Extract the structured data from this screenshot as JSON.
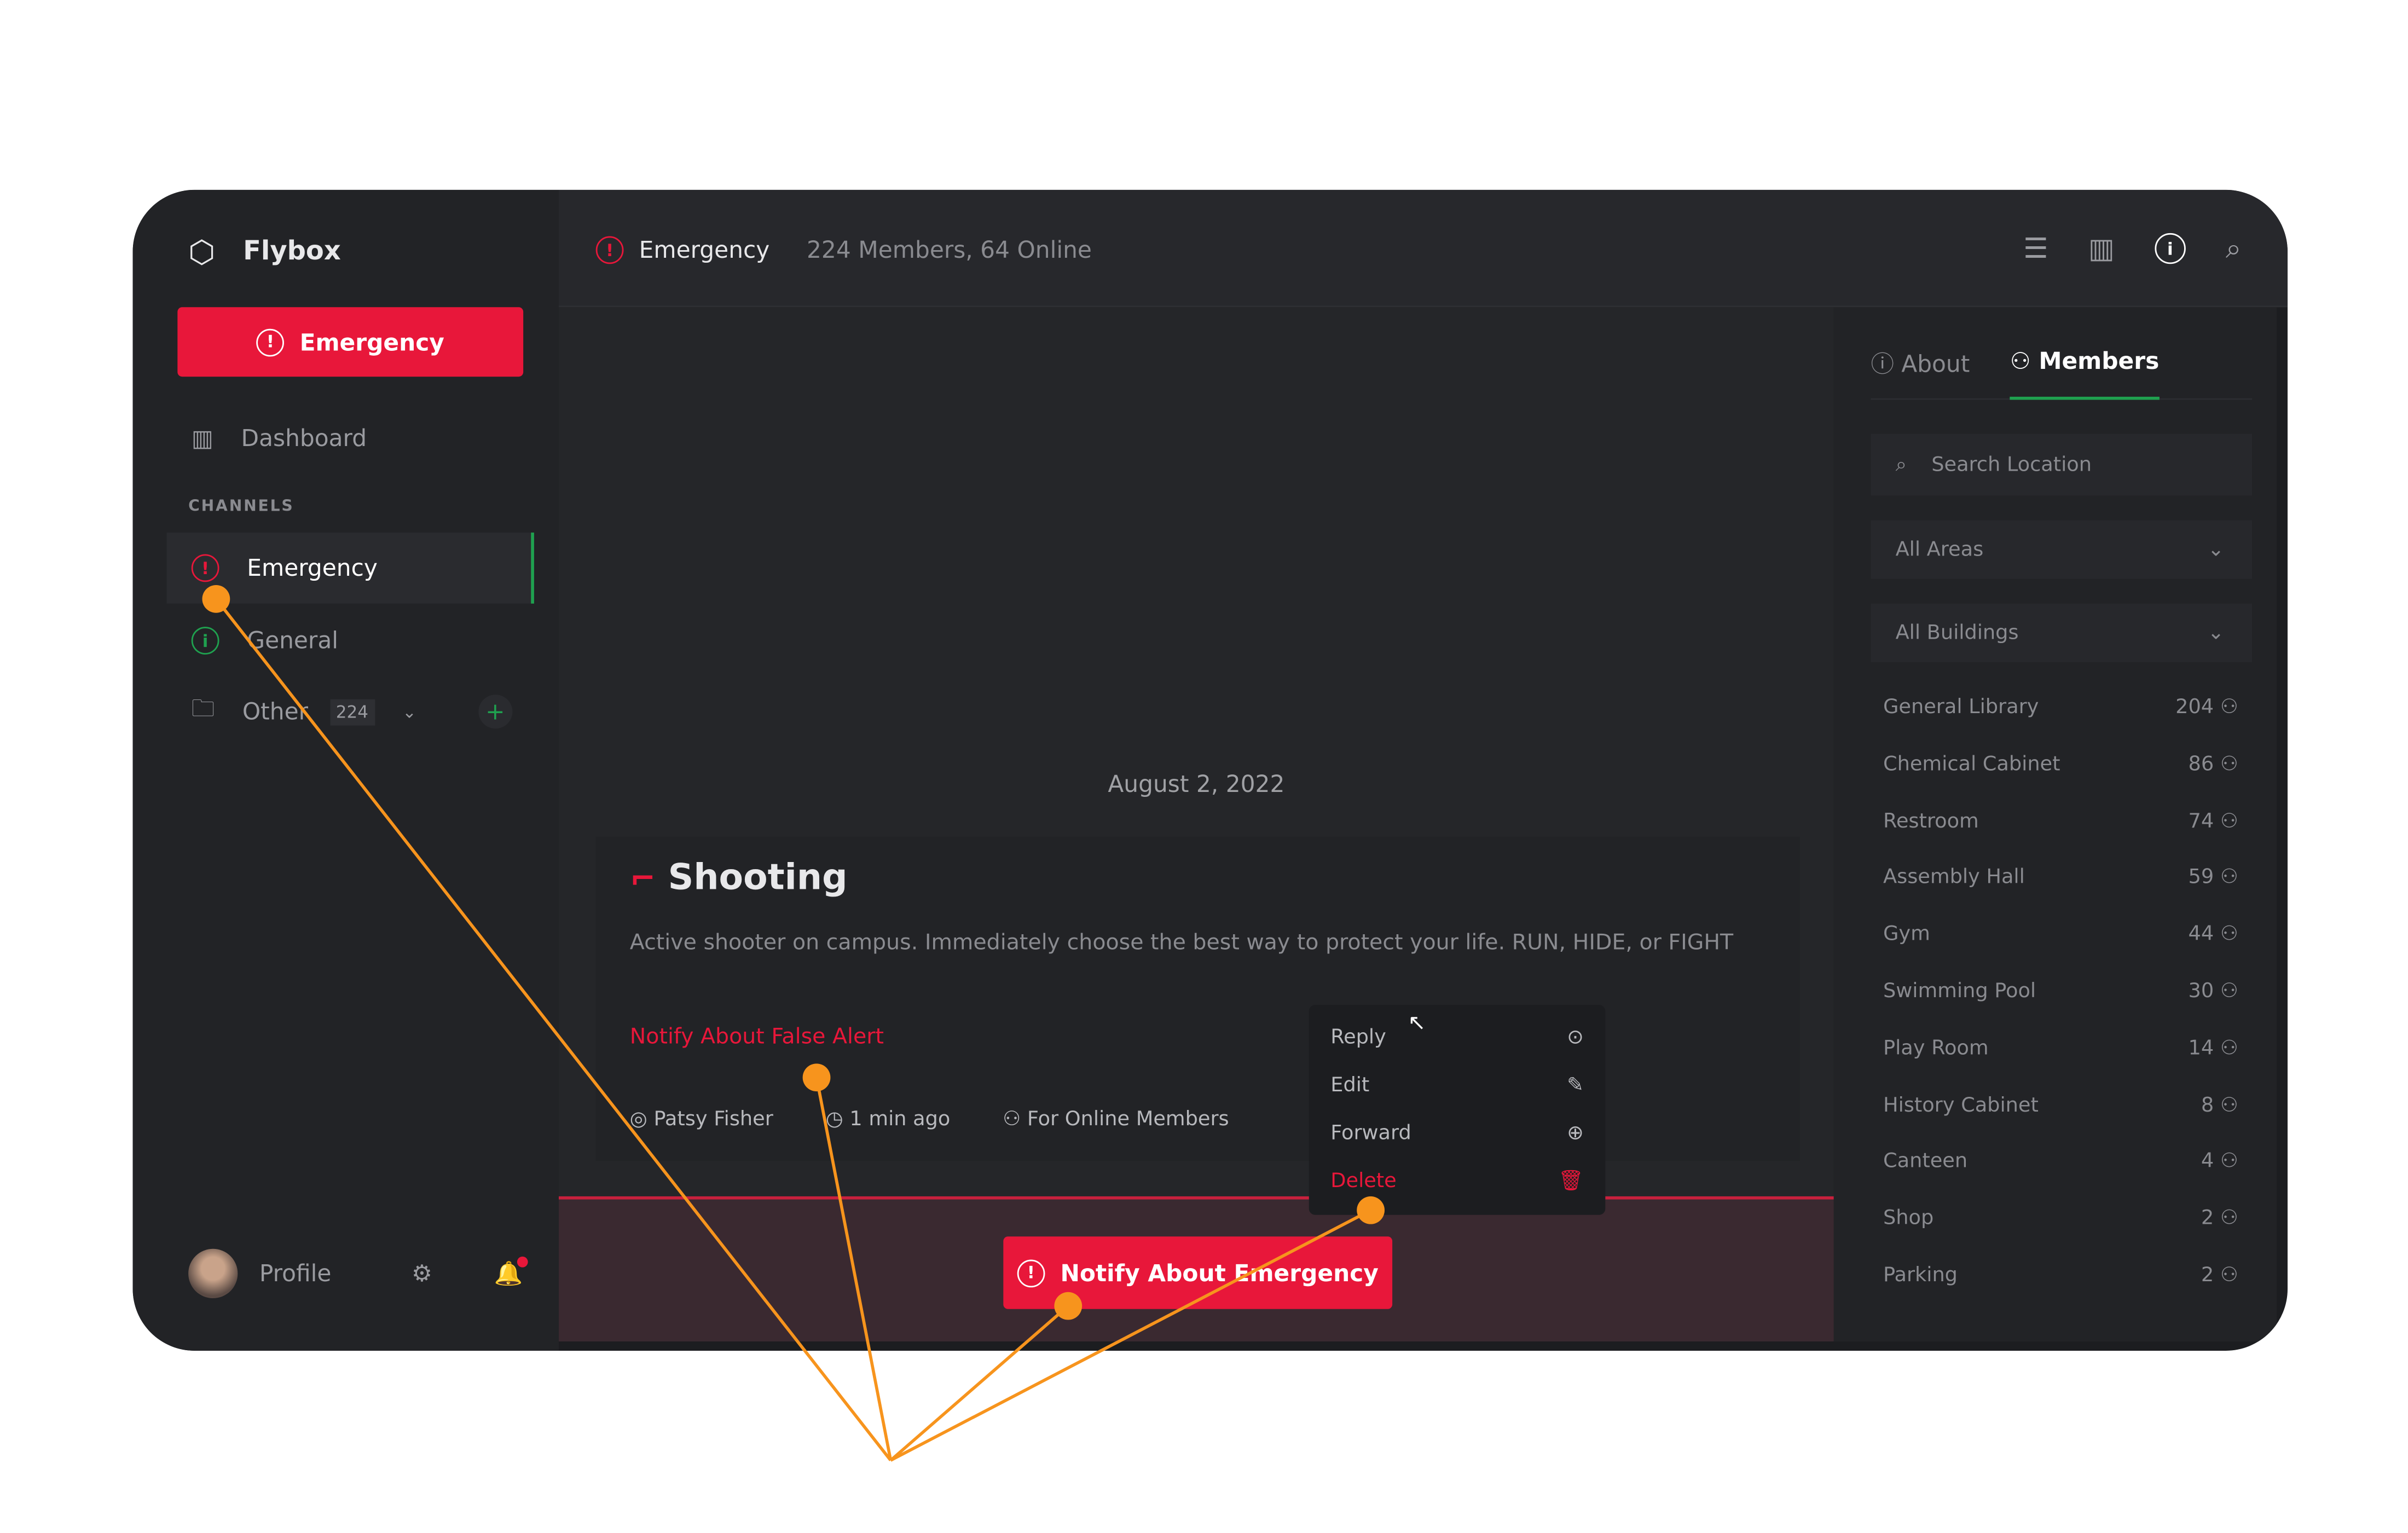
{
  "app": {
    "name": "Flybox",
    "emergency_button": "Emergency"
  },
  "sidebar": {
    "dashboard": "Dashboard",
    "section": "CHANNELS",
    "channels": [
      {
        "label": "Emergency",
        "icon": "alert-icon",
        "active": true
      },
      {
        "label": "General",
        "icon": "info-icon"
      },
      {
        "label": "Other",
        "icon": "folder-icon",
        "badge": "224"
      }
    ],
    "profile": "Profile"
  },
  "header": {
    "channel": "Emergency",
    "stats": "224 Members, 64 Online"
  },
  "feed": {
    "date": "August 2, 2022",
    "post": {
      "title": "Shooting",
      "body": "Active shooter on campus. Immediately choose the best way to protect your life. RUN, HIDE, or FIGHT",
      "false_alert": "Notify About False Alert",
      "author": "Patsy Fisher",
      "time": "1 min ago",
      "audience": "For Online Members"
    },
    "context_menu": [
      "Reply",
      "Edit",
      "Forward",
      "Delete"
    ],
    "notify_button": "Notify About Emergency"
  },
  "right_panel": {
    "tabs": [
      "About",
      "Members"
    ],
    "active_tab": "Members",
    "search_placeholder": "Search Location",
    "areas": "All Areas",
    "buildings": "All Buildings",
    "locations": [
      {
        "name": "General Library",
        "count": "204"
      },
      {
        "name": "Chemical Cabinet",
        "count": "86"
      },
      {
        "name": "Restroom",
        "count": "74"
      },
      {
        "name": "Assembly Hall",
        "count": "59"
      },
      {
        "name": "Gym",
        "count": "44"
      },
      {
        "name": "Swimming Pool",
        "count": "30"
      },
      {
        "name": "Play Room",
        "count": "14"
      },
      {
        "name": "History Cabinet",
        "count": "8"
      },
      {
        "name": "Canteen",
        "count": "4"
      },
      {
        "name": "Shop",
        "count": "2"
      },
      {
        "name": "Parking",
        "count": "2"
      }
    ]
  },
  "colors": {
    "accent": "#e8173a",
    "green": "#1fa14f",
    "annotation": "#f7941d"
  }
}
